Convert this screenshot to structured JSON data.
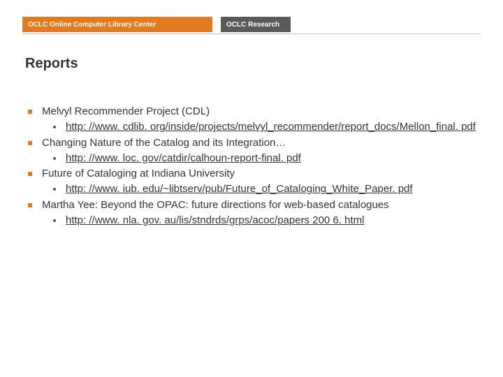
{
  "header": {
    "logo_main": "OCLC Online Computer Library Center",
    "logo_research": "OCLC Research"
  },
  "title": "Reports",
  "reports": [
    {
      "label": "Melvyl Recommender Project (CDL)",
      "url": "http: //www. cdlib. org/inside/projects/melvyl_recommender/report_docs/Mellon_final. pdf"
    },
    {
      "label": "Changing Nature of the Catalog and its Integration…",
      "url": "http: //www. loc. gov/catdir/calhoun-report-final. pdf"
    },
    {
      "label": "Future of Cataloging at Indiana University",
      "url": "http: //www. iub. edu/~libtserv/pub/Future_of_Cataloging_White_Paper. pdf"
    },
    {
      "label": "Martha Yee: Beyond the OPAC: future directions for web-based catalogues",
      "url": "http: //www. nla. gov. au/lis/stndrds/grps/acoc/papers 200 6. html"
    }
  ]
}
